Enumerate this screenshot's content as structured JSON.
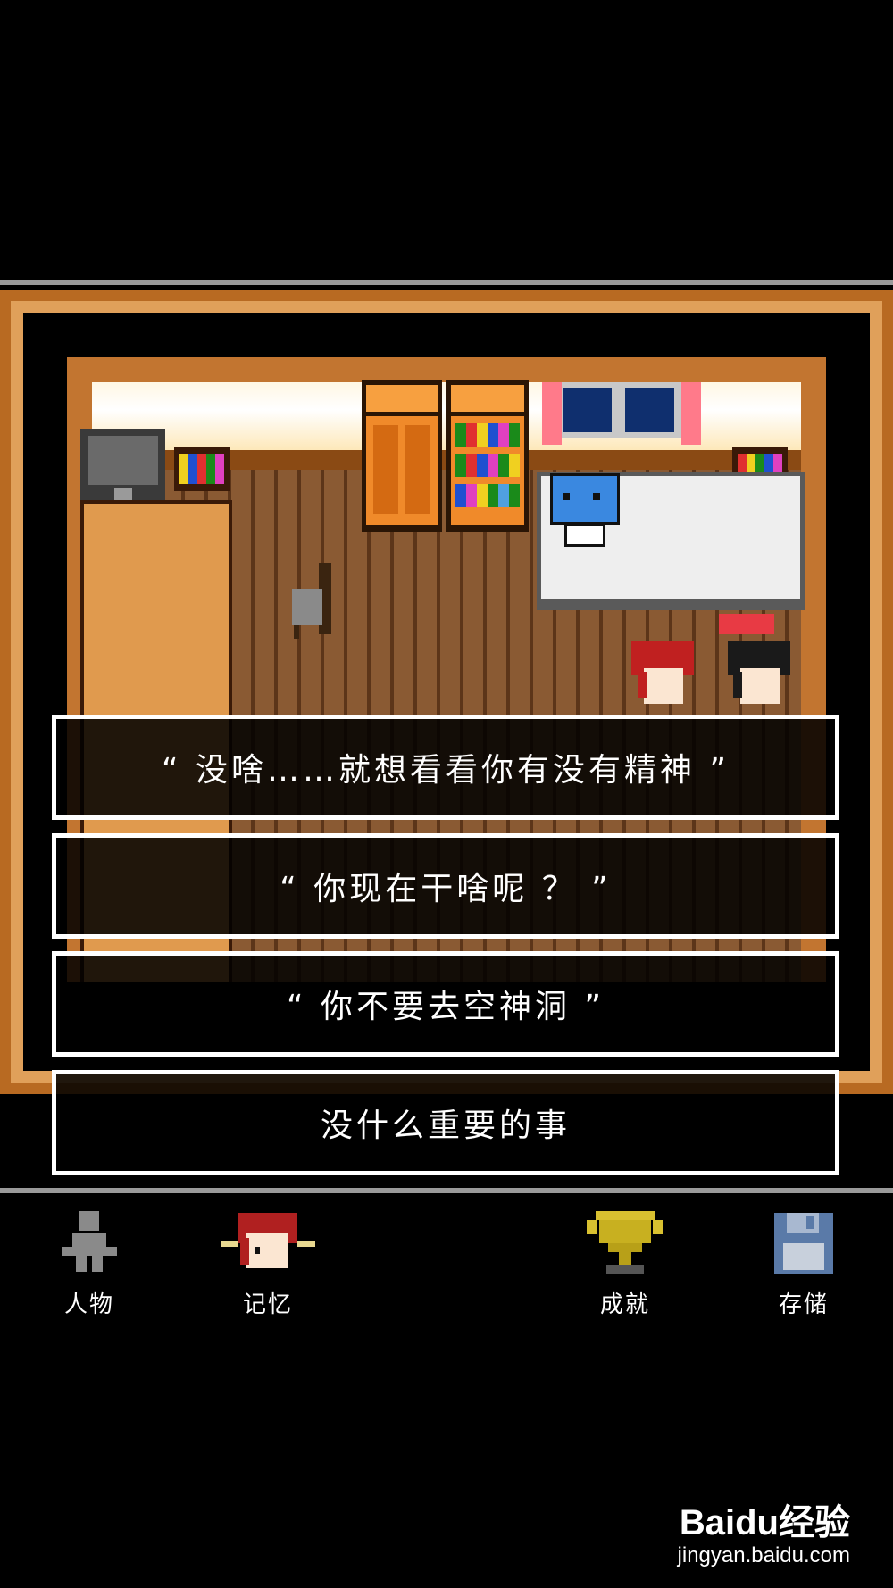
{
  "dialog": {
    "choices": [
      "“ 没啥……就想看看你有没有精神 ”",
      "“ 你现在干啥呢 ？ ”",
      "“ 你不要去空神洞 ”",
      "没什么重要的事"
    ]
  },
  "menu": {
    "items": [
      {
        "label": "人物",
        "icon": "person-icon"
      },
      {
        "label": "记忆",
        "icon": "memory-portrait-icon"
      },
      {
        "label": "成就",
        "icon": "trophy-icon"
      },
      {
        "label": "存储",
        "icon": "floppy-disk-icon"
      }
    ]
  },
  "watermark": {
    "brand": "Baidu经验",
    "url": "jingyan.baidu.com"
  },
  "colors": {
    "frame": "#b86a22",
    "floor": "#8a5a33",
    "choice_border": "#ffffff",
    "trophy": "#c8b020",
    "floppy": "#5a7aa8"
  }
}
